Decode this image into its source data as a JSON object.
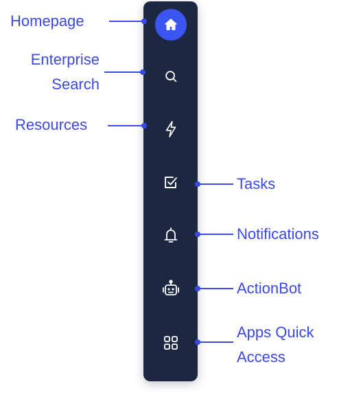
{
  "callouts": {
    "homepage": "Homepage",
    "enterprise_search_line1": "Enterprise",
    "enterprise_search_line2": "Search",
    "resources": "Resources",
    "tasks": "Tasks",
    "notifications": "Notifications",
    "actionbot": "ActionBot",
    "apps_quick_access_line1": "Apps Quick",
    "apps_quick_access_line2": "Access"
  },
  "sidebar": {
    "items": [
      {
        "id": "home",
        "icon": "home-icon",
        "active": true
      },
      {
        "id": "search",
        "icon": "search-icon"
      },
      {
        "id": "resources",
        "icon": "lightning-icon"
      },
      {
        "id": "tasks",
        "icon": "checkbox-icon"
      },
      {
        "id": "notifications",
        "icon": "bell-icon"
      },
      {
        "id": "actionbot",
        "icon": "robot-icon"
      },
      {
        "id": "apps",
        "icon": "grid-icon"
      }
    ]
  },
  "colors": {
    "sidebar_bg": "#1c2842",
    "accent": "#3b56f0",
    "callout": "#3a49e3",
    "icon": "#ffffff"
  }
}
